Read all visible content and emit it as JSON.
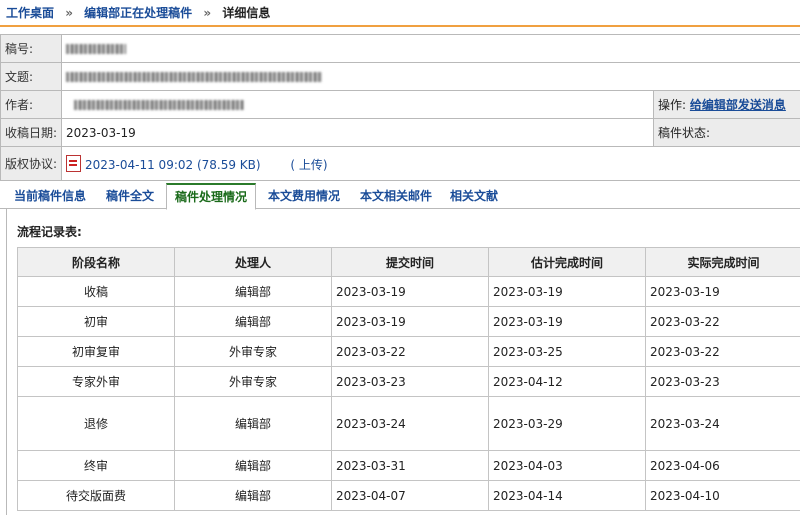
{
  "breadcrumb": {
    "items": [
      "工作桌面",
      "编辑部正在处理稿件"
    ],
    "separator": "»",
    "current": "详细信息"
  },
  "info": {
    "manuscript_no_label": "稿号:",
    "title_label": "文题:",
    "author_label": "作者:",
    "received_label": "收稿日期:",
    "received_value": "2023-03-19",
    "copyright_label": "版权协议:",
    "copyright_file": "2023-04-11 09:02 (78.59 KB)",
    "upload_label": "( 上传)",
    "operation_label": "操作:",
    "operation_link": "给编辑部发送消息",
    "status_label": "稿件状态:"
  },
  "tabs": [
    {
      "label": "当前稿件信息",
      "active": false
    },
    {
      "label": "稿件全文",
      "active": false
    },
    {
      "label": "稿件处理情况",
      "active": true
    },
    {
      "label": "本文费用情况",
      "active": false
    },
    {
      "label": "本文相关邮件",
      "active": false
    },
    {
      "label": "相关文献",
      "active": false
    }
  ],
  "flow": {
    "title": "流程记录表:",
    "headers": [
      "阶段名称",
      "处理人",
      "提交时间",
      "估计完成时间",
      "实际完成时间"
    ],
    "rows": [
      [
        "收稿",
        "编辑部",
        "2023-03-19",
        "2023-03-19",
        "2023-03-19"
      ],
      [
        "初审",
        "编辑部",
        "2023-03-19",
        "2023-03-19",
        "2023-03-22"
      ],
      [
        "初审复审",
        "外审专家",
        "2023-03-22",
        "2023-03-25",
        "2023-03-22"
      ],
      [
        "专家外审",
        "外审专家",
        "2023-03-23",
        "2023-04-12",
        "2023-03-23"
      ],
      [
        "退修",
        "编辑部",
        "2023-03-24",
        "2023-03-29",
        "2023-03-24"
      ],
      [
        "终审",
        "编辑部",
        "2023-03-31",
        "2023-04-03",
        "2023-04-06"
      ],
      [
        "待交版面费",
        "编辑部",
        "2023-04-07",
        "2023-04-14",
        "2023-04-10"
      ]
    ]
  },
  "colors": {
    "link": "#1a4c98",
    "accent_line": "#f0a040",
    "active_tab": "#2a7a2a",
    "label_bg": "#ececec"
  }
}
